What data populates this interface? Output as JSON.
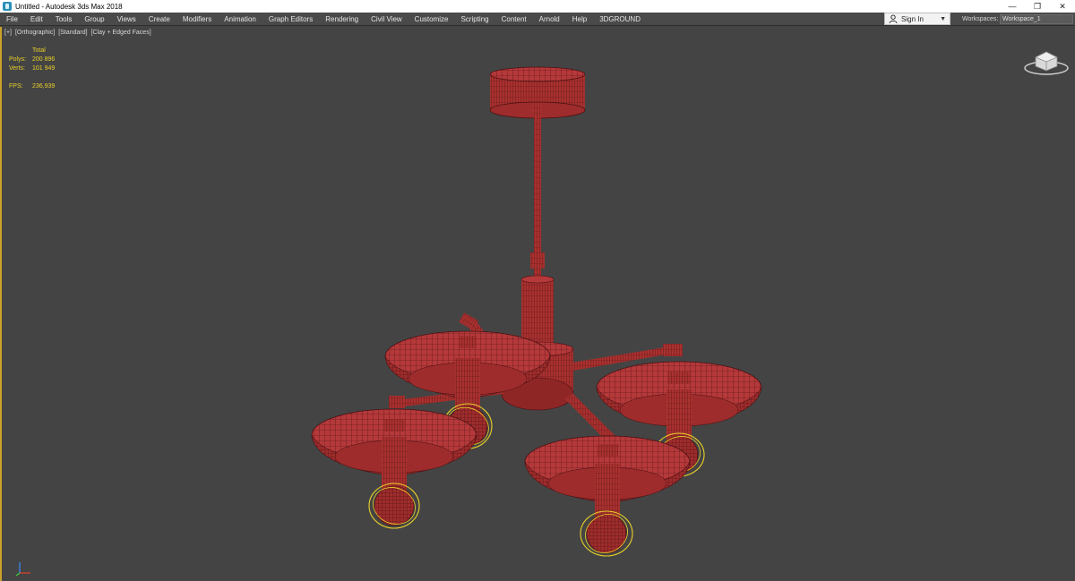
{
  "window": {
    "title": "Untitled - Autodesk 3ds Max 2018",
    "controls": {
      "minimize": "—",
      "restore": "❐",
      "close": "✕"
    }
  },
  "menu": {
    "items": [
      "File",
      "Edit",
      "Tools",
      "Group",
      "Views",
      "Create",
      "Modifiers",
      "Animation",
      "Graph Editors",
      "Rendering",
      "Civil View",
      "Customize",
      "Scripting",
      "Content",
      "Arnold",
      "Help",
      "3DGROUND"
    ]
  },
  "account": {
    "sign_in": "Sign In"
  },
  "workspaces": {
    "label": "Workspaces:",
    "selected": "Workspace_1"
  },
  "viewport": {
    "labels": [
      "[+]",
      "[Orthographic]",
      "[Standard]",
      "[Clay + Edged Faces]"
    ],
    "stats": {
      "header": "Total",
      "polys_label": "Polys:",
      "polys_value": "200 896",
      "verts_label": "Verts:",
      "verts_value": "101 949",
      "fps_label": "FPS:",
      "fps_value": "236,939"
    }
  },
  "colors": {
    "viewport_bg": "#444444",
    "model_fill": "#b5393a",
    "model_wire": "#4a0f12",
    "selection_gizmo": "#e8d02a",
    "viewport_border": "#c9a227"
  },
  "icons": {
    "app": "3dsmax-app-icon",
    "user": "user-icon",
    "viewcube": "viewcube-icon",
    "axis": "axis-tripod-icon"
  }
}
